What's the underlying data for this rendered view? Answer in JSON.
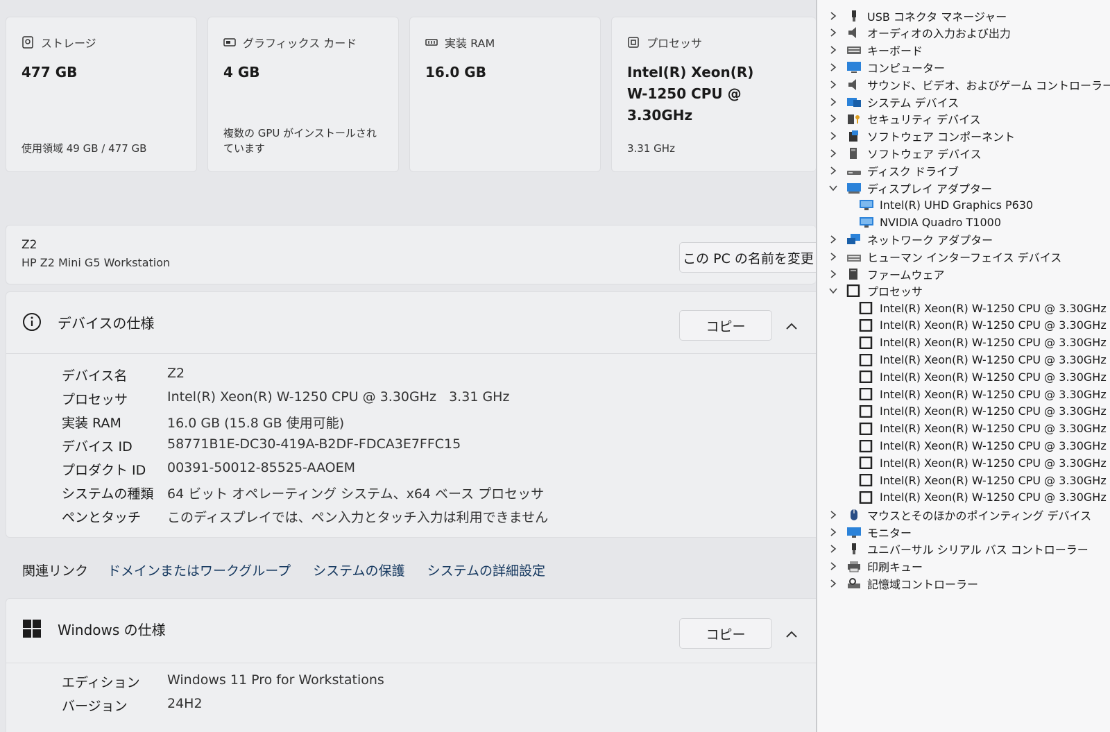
{
  "settings": {
    "cards": [
      {
        "title": "ストレージ",
        "value": "477 GB",
        "sub": "使用領域 49 GB / 477 GB",
        "icon": "storage-icon"
      },
      {
        "title": "グラフィックス カード",
        "value": "4 GB",
        "sub": "複数の GPU がインストールされています",
        "icon": "gpu-icon"
      },
      {
        "title": "実装 RAM",
        "value": "16.0 GB",
        "sub": "",
        "icon": "ram-icon"
      },
      {
        "title": "プロセッサ",
        "value": "Intel(R) Xeon(R) W-1250 CPU @ 3.30GHz",
        "sub": "3.31 GHz",
        "icon": "processor-icon"
      }
    ],
    "pc": {
      "name": "Z2",
      "model": "HP Z2 Mini G5 Workstation",
      "rename_label": "この PC の名前を変更"
    },
    "device_spec": {
      "title": "デバイスの仕様",
      "copy_label": "コピー",
      "rows": [
        {
          "label": "デバイス名",
          "value": "Z2"
        },
        {
          "label": "プロセッサ",
          "value": "Intel(R) Xeon(R) W-1250 CPU @ 3.30GHz   3.31 GHz"
        },
        {
          "label": "実装 RAM",
          "value": "16.0 GB (15.8 GB 使用可能)"
        },
        {
          "label": "デバイス ID",
          "value": "58771B1E-DC30-419A-B2DF-FDCA3E7FFC15"
        },
        {
          "label": "プロダクト ID",
          "value": "00391-50012-85525-AAOEM"
        },
        {
          "label": "システムの種類",
          "value": "64 ビット オペレーティング システム、x64 ベース プロセッサ"
        },
        {
          "label": "ペンとタッチ",
          "value": "このディスプレイでは、ペン入力とタッチ入力は利用できません"
        }
      ]
    },
    "related": {
      "title": "関連リンク",
      "links": [
        "ドメインまたはワークグループ",
        "システムの保護",
        "システムの詳細設定"
      ]
    },
    "windows_spec": {
      "title": "Windows の仕様",
      "copy_label": "コピー",
      "rows": [
        {
          "label": "エディション",
          "value": "Windows 11 Pro for Workstations"
        },
        {
          "label": "バージョン",
          "value": "24H2"
        }
      ]
    }
  },
  "device_manager": {
    "items": [
      {
        "label": "USB コネクタ マネージャー",
        "expanded": false,
        "icon": "usb-connector-icon"
      },
      {
        "label": "オーディオの入力および出力",
        "expanded": false,
        "icon": "speaker-icon"
      },
      {
        "label": "キーボード",
        "expanded": false,
        "icon": "keyboard-icon"
      },
      {
        "label": "コンピューター",
        "expanded": false,
        "icon": "computer-icon"
      },
      {
        "label": "サウンド、ビデオ、およびゲーム コントローラー",
        "expanded": false,
        "icon": "speaker-icon"
      },
      {
        "label": "システム デバイス",
        "expanded": false,
        "icon": "system-folder-icon"
      },
      {
        "label": "セキュリティ デバイス",
        "expanded": false,
        "icon": "security-key-icon"
      },
      {
        "label": "ソフトウェア コンポーネント",
        "expanded": false,
        "icon": "software-component-icon"
      },
      {
        "label": "ソフトウェア デバイス",
        "expanded": false,
        "icon": "software-device-icon"
      },
      {
        "label": "ディスク ドライブ",
        "expanded": false,
        "icon": "disk-drive-icon"
      },
      {
        "label": "ディスプレイ アダプター",
        "expanded": true,
        "icon": "display-adapter-icon",
        "children": [
          "Intel(R) UHD Graphics P630",
          "NVIDIA Quadro T1000"
        ]
      },
      {
        "label": "ネットワーク アダプター",
        "expanded": false,
        "icon": "network-icon"
      },
      {
        "label": "ヒューマン インターフェイス デバイス",
        "expanded": false,
        "icon": "hid-icon"
      },
      {
        "label": "ファームウェア",
        "expanded": false,
        "icon": "firmware-icon"
      },
      {
        "label": "プロセッサ",
        "expanded": true,
        "icon": "processor-icon",
        "children": [
          "Intel(R) Xeon(R) W-1250 CPU @ 3.30GHz",
          "Intel(R) Xeon(R) W-1250 CPU @ 3.30GHz",
          "Intel(R) Xeon(R) W-1250 CPU @ 3.30GHz",
          "Intel(R) Xeon(R) W-1250 CPU @ 3.30GHz",
          "Intel(R) Xeon(R) W-1250 CPU @ 3.30GHz",
          "Intel(R) Xeon(R) W-1250 CPU @ 3.30GHz",
          "Intel(R) Xeon(R) W-1250 CPU @ 3.30GHz",
          "Intel(R) Xeon(R) W-1250 CPU @ 3.30GHz",
          "Intel(R) Xeon(R) W-1250 CPU @ 3.30GHz",
          "Intel(R) Xeon(R) W-1250 CPU @ 3.30GHz",
          "Intel(R) Xeon(R) W-1250 CPU @ 3.30GHz",
          "Intel(R) Xeon(R) W-1250 CPU @ 3.30GHz"
        ]
      },
      {
        "label": "マウスとそのほかのポインティング デバイス",
        "expanded": false,
        "icon": "mouse-icon"
      },
      {
        "label": "モニター",
        "expanded": false,
        "icon": "monitor-icon"
      },
      {
        "label": "ユニバーサル シリアル バス コントローラー",
        "expanded": false,
        "icon": "usb-icon"
      },
      {
        "label": "印刷キュー",
        "expanded": false,
        "icon": "printer-icon"
      },
      {
        "label": "記憶域コントローラー",
        "expanded": false,
        "icon": "storage-controller-icon"
      }
    ]
  },
  "colors": {
    "accent": "#14375e",
    "panel": "#eeeff1",
    "background": "#e6e7ea"
  }
}
